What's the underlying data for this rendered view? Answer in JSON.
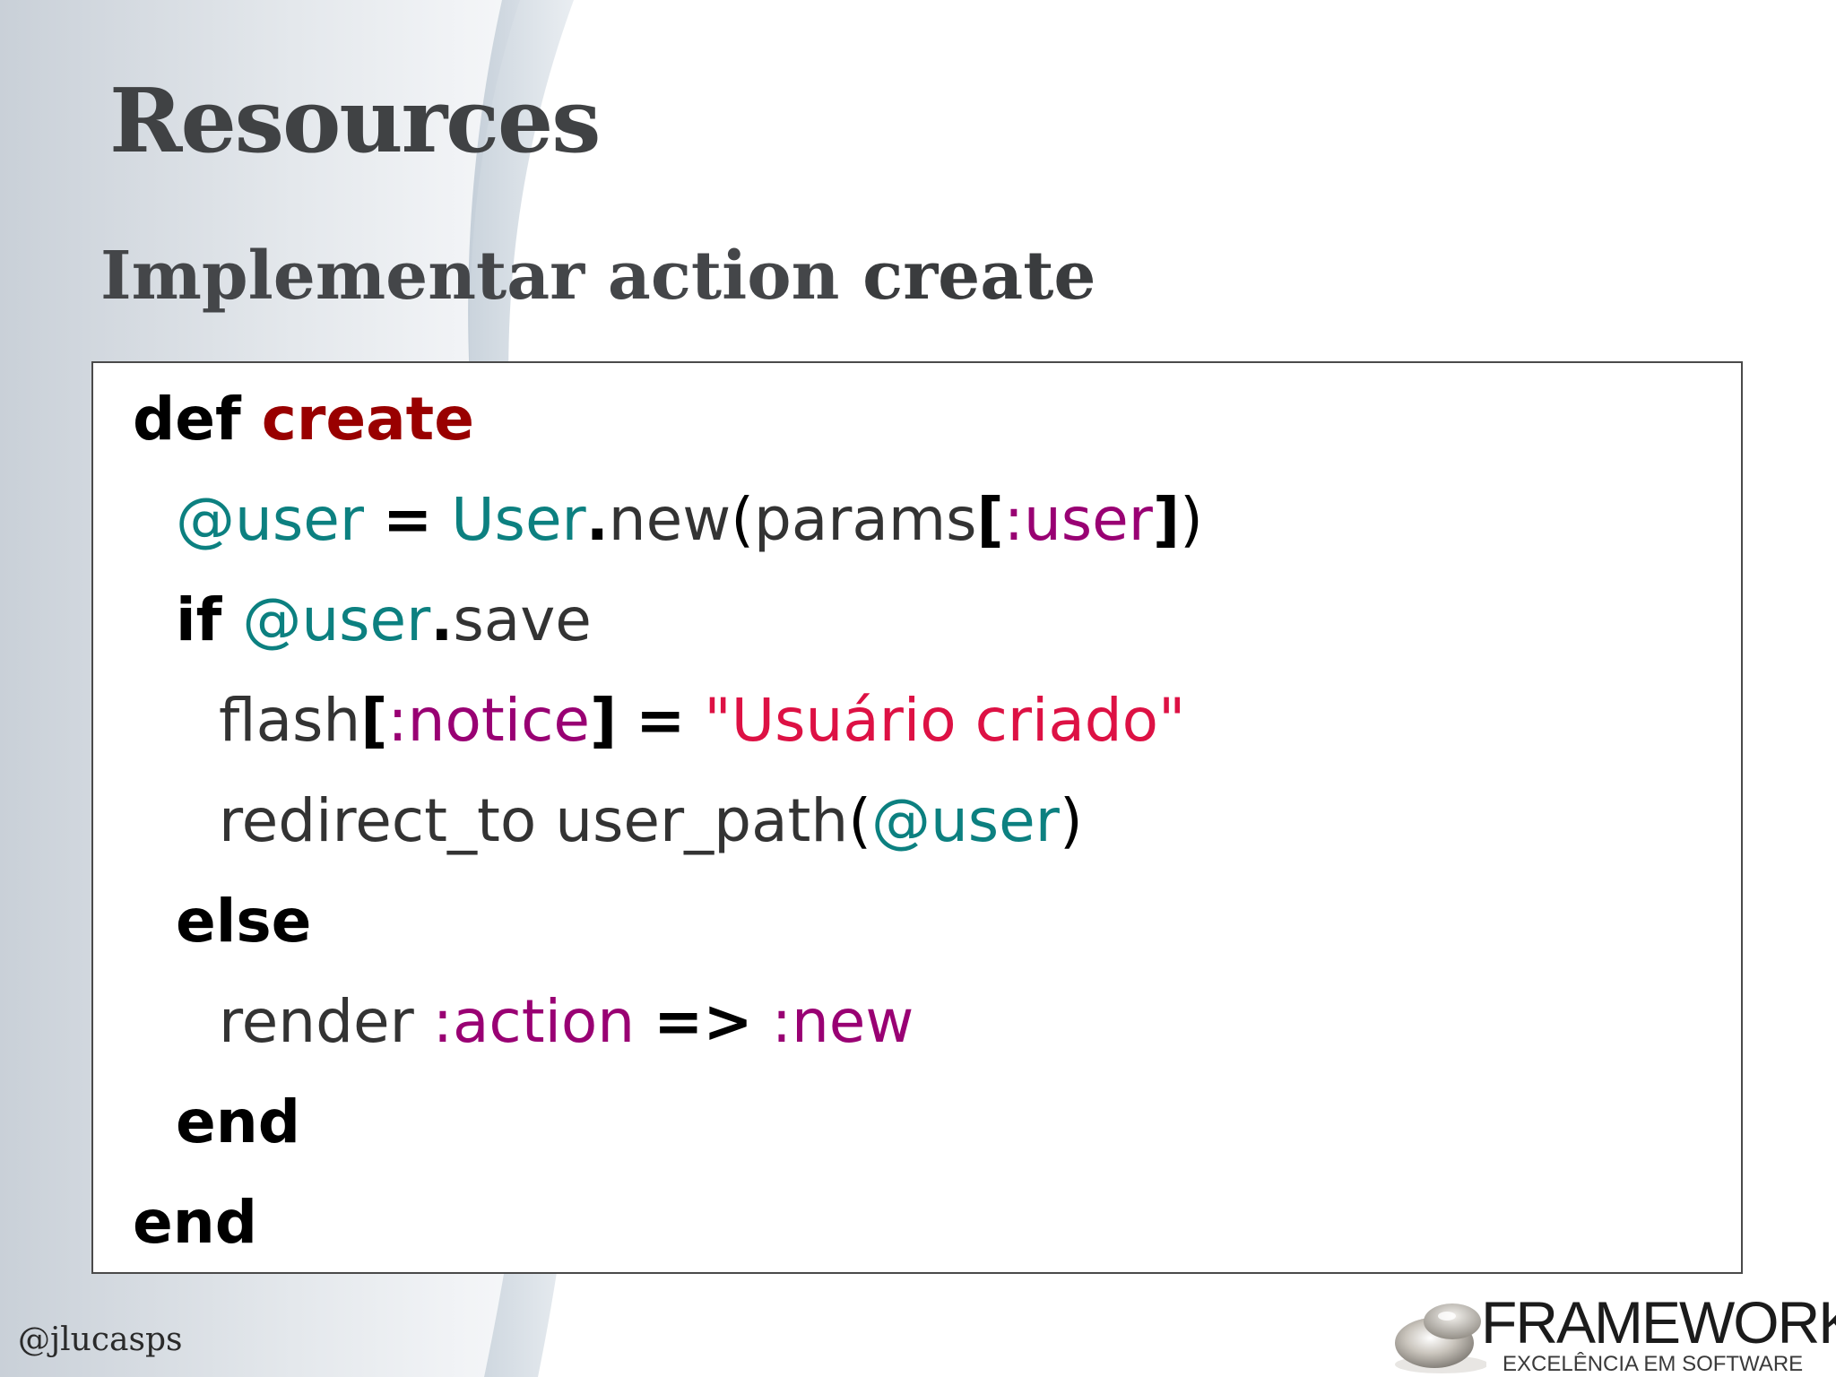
{
  "slide": {
    "title": "Resources",
    "subtitle": {
      "prefix": "Implementar action ",
      "keyword": "create"
    },
    "code": {
      "lines": [
        {
          "indent": 0,
          "tokens": [
            {
              "text": "def ",
              "type": "keyword"
            },
            {
              "text": "create",
              "type": "function"
            }
          ]
        },
        {
          "indent": 1,
          "tokens": [
            {
              "text": "@user",
              "type": "ivar"
            },
            {
              "text": " ",
              "type": "plain"
            },
            {
              "text": "=",
              "type": "operator"
            },
            {
              "text": " ",
              "type": "plain"
            },
            {
              "text": "User",
              "type": "constant"
            },
            {
              "text": ".",
              "type": "operator"
            },
            {
              "text": "new",
              "type": "plain"
            },
            {
              "text": "(",
              "type": "punct"
            },
            {
              "text": "params",
              "type": "plain"
            },
            {
              "text": "[",
              "type": "operator"
            },
            {
              "text": ":user",
              "type": "symbol"
            },
            {
              "text": "]",
              "type": "operator"
            },
            {
              "text": ")",
              "type": "punct"
            }
          ]
        },
        {
          "indent": 1,
          "tokens": [
            {
              "text": "if ",
              "type": "keyword"
            },
            {
              "text": "@user",
              "type": "ivar"
            },
            {
              "text": ".",
              "type": "operator"
            },
            {
              "text": "save",
              "type": "plain"
            }
          ]
        },
        {
          "indent": 2,
          "tokens": [
            {
              "text": "flash",
              "type": "plain"
            },
            {
              "text": "[",
              "type": "operator"
            },
            {
              "text": ":notice",
              "type": "symbol"
            },
            {
              "text": "]",
              "type": "operator"
            },
            {
              "text": " ",
              "type": "plain"
            },
            {
              "text": "=",
              "type": "operator"
            },
            {
              "text": " ",
              "type": "plain"
            },
            {
              "text": "\"Usuário criado\"",
              "type": "string"
            }
          ]
        },
        {
          "indent": 2,
          "tokens": [
            {
              "text": "redirect_to user_path",
              "type": "plain"
            },
            {
              "text": "(",
              "type": "punct"
            },
            {
              "text": "@user",
              "type": "ivar"
            },
            {
              "text": ")",
              "type": "punct"
            }
          ]
        },
        {
          "indent": 1,
          "tokens": [
            {
              "text": "else",
              "type": "keyword"
            }
          ]
        },
        {
          "indent": 2,
          "tokens": [
            {
              "text": "render ",
              "type": "plain"
            },
            {
              "text": ":action",
              "type": "symbol"
            },
            {
              "text": " ",
              "type": "plain"
            },
            {
              "text": "=>",
              "type": "operator"
            },
            {
              "text": " ",
              "type": "plain"
            },
            {
              "text": ":new",
              "type": "symbol"
            }
          ]
        },
        {
          "indent": 1,
          "tokens": [
            {
              "text": "end",
              "type": "keyword"
            }
          ]
        },
        {
          "indent": 0,
          "tokens": [
            {
              "text": "end",
              "type": "keyword"
            }
          ]
        }
      ]
    },
    "footer": {
      "handle": "@jlucasps",
      "logo_name": "FRAMEWORK",
      "logo_tagline": "EXCELÊNCIA EM SOFTWARE",
      "logo_icon": "disc-logo-icon"
    },
    "colors": {
      "title": "#404244",
      "keyword": "#000000",
      "function": "#990000",
      "ivar": "#0c8080",
      "symbol": "#990073",
      "string": "#dd1144",
      "plain": "#333333"
    }
  }
}
